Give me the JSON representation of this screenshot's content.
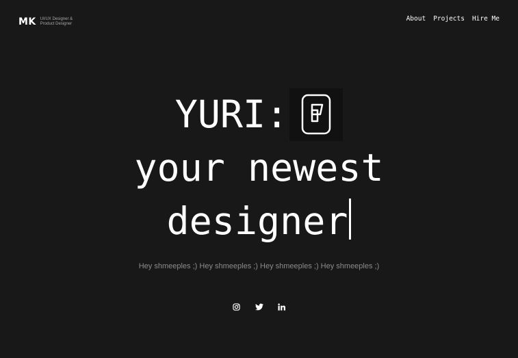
{
  "header": {
    "logo_mark": "MK",
    "logo_sub_line1": "UI/UX Designer &",
    "logo_sub_line2": "Product Designer",
    "nav": [
      {
        "label": "About"
      },
      {
        "label": "Projects"
      },
      {
        "label": "Hire Me"
      }
    ]
  },
  "hero": {
    "line1": "YURI:",
    "line2": "your newest",
    "line3": "designer",
    "badge_icon": "phone-with-card-icon"
  },
  "tagline": "Hey shmeeples ;) Hey shmeeples ;) Hey shmeeples ;) Hey shmeeples ;)",
  "socials": [
    {
      "icon": "instagram-icon"
    },
    {
      "icon": "twitter-icon"
    },
    {
      "icon": "linkedin-icon"
    }
  ]
}
